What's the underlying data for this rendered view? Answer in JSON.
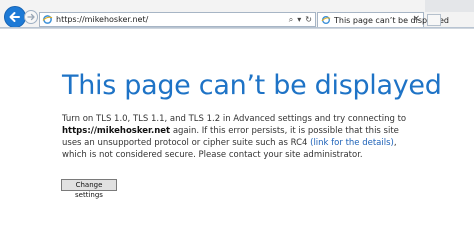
{
  "browser": {
    "address_url": "https://mikehosker.net/",
    "tab_title": "This page can’t be displayed",
    "tab_close_glyph": "×",
    "search_glyph": "⌕",
    "address_dropdown_glyph": "▾",
    "refresh_glyph": "↻",
    "accent_color": "#1d7ad6"
  },
  "page": {
    "heading": "This page can’t be displayed",
    "heading_color": "#1e73c6",
    "paragraph": {
      "part1": "Turn on TLS 1.0, TLS 1.1, and TLS 1.2 in Advanced settings and try connecting to ",
      "host": "https://mikehosker.net",
      "part2": " again. If this error persists, it is possible that this site uses an unsupported protocol or cipher suite such as RC4 ",
      "link_text": "(link for the details)",
      "part3": ", which is not considered secure. Please contact your site administrator."
    },
    "change_settings_button": "Change settings"
  }
}
